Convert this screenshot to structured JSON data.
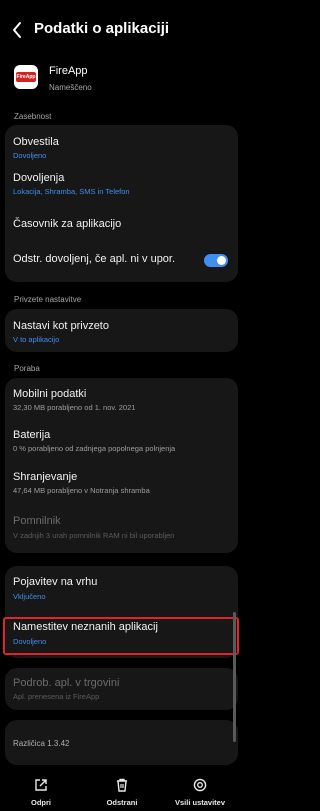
{
  "header": {
    "title": "Podatki o aplikaciji"
  },
  "app": {
    "name": "FireApp",
    "status": "Nameščeno",
    "logo_text": "FireApp"
  },
  "sections": {
    "zasebnost": "Zasebnost",
    "privzete": "Privzete nastavitve",
    "poraba": "Poraba"
  },
  "rows": {
    "obvestila": {
      "title": "Obvestila",
      "sub": "Dovoljeno"
    },
    "dovoljenja": {
      "title": "Dovoljenja",
      "sub": "Lokacija, Shramba, SMS in Telefon"
    },
    "casovnik": {
      "title": "Časovnik za aplikacijo"
    },
    "odstr": {
      "title": "Odstr. dovoljenj, če apl. ni v upor.",
      "toggle_on": true
    },
    "nastavi_privzeto": {
      "title": "Nastavi kot privzeto",
      "sub": "V to aplikacijo"
    },
    "mobilni": {
      "title": "Mobilni podatki",
      "sub": "32,30 MB porabljeno od 1. nov. 2021"
    },
    "baterija": {
      "title": "Baterija",
      "sub": "0 % porabljeno od zadnjega popolnega polnjenja"
    },
    "shranjevanje": {
      "title": "Shranjevanje",
      "sub": "47,64 MB porabljeno v Notranja shramba"
    },
    "pomnilnik": {
      "title": "Pomnilnik",
      "sub": "V zadnjih 3 urah pomnilnik RAM ni bil uporabljen"
    },
    "pojavitev": {
      "title": "Pojavitev na vrhu",
      "sub": "Vključeno"
    },
    "namestitev": {
      "title": "Namestitev neznanih aplikacij",
      "sub": "Dovoljeno"
    },
    "podrob": {
      "title": "Podrob. apl. v trgovini",
      "sub": "Apl. prenesena iz FireApp"
    },
    "razlicica": {
      "title": "Različica 1.3.42"
    }
  },
  "bottom": {
    "odpri": "Odpri",
    "odstrani": "Odstrani",
    "vsili": "Vsili ustavitev"
  },
  "colors": {
    "accent_blue": "#3f8ef0",
    "highlight_red": "#e1232e",
    "card_bg": "#171717"
  }
}
